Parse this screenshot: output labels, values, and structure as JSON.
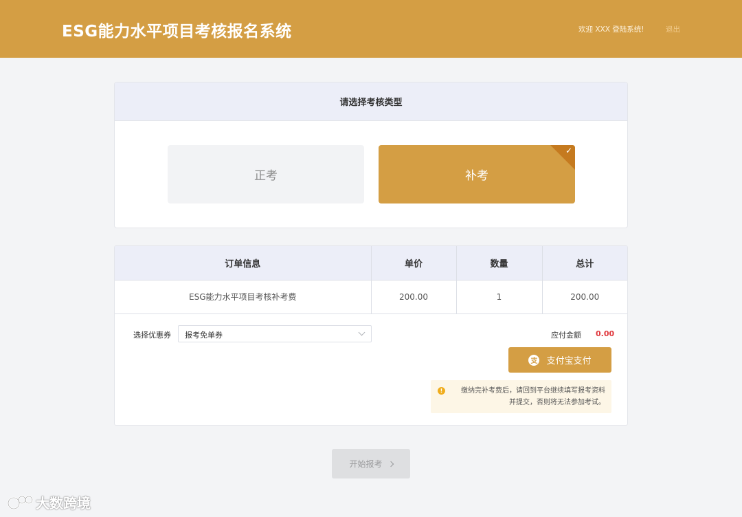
{
  "header": {
    "title": "ESG能力水平项目考核报名系统",
    "welcome": "欢迎 XXX 登陆系统!",
    "logout": "退出"
  },
  "exam_type": {
    "heading": "请选择考核类型",
    "options": [
      {
        "label": "正考",
        "selected": false
      },
      {
        "label": "补考",
        "selected": true
      }
    ],
    "check_icon": "check-icon",
    "accent_color": "#d49e44"
  },
  "order": {
    "columns": [
      "订单信息",
      "单价",
      "数量",
      "总计"
    ],
    "rows": [
      {
        "item": "ESG能力水平项目考核补考费",
        "price": "200.00",
        "qty": "1",
        "total": "200.00"
      }
    ],
    "coupon_label": "选择优惠券",
    "coupon_value": "报考免单券",
    "amount_label": "应付金额",
    "amount_value": "0.00",
    "amount_color": "#e0393e",
    "pay_button": "支付宝支付",
    "pay_icon": "alipay-icon",
    "notice_icon": "warning-icon",
    "notice_line1": "缴纳完补考费后，请回到平台继续填写报考资料",
    "notice_line2": "并提交，否则将无法参加考试。"
  },
  "start_button": "开始报考",
  "watermark": "大数跨境"
}
